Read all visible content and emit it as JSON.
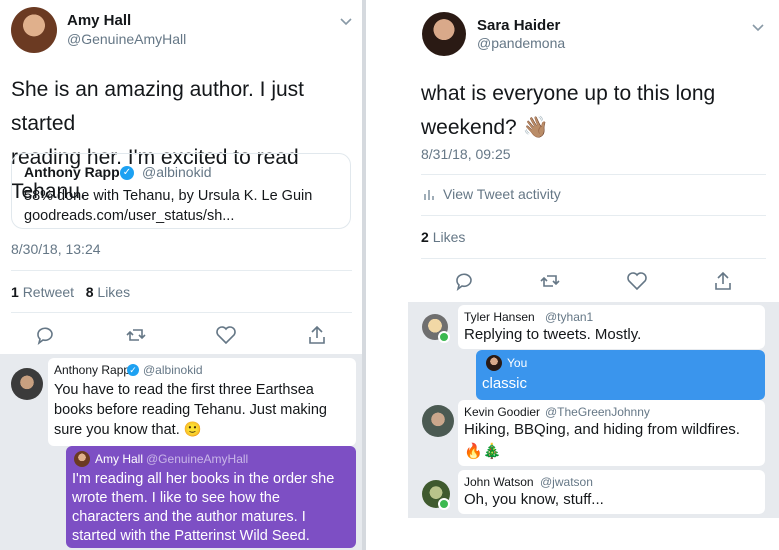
{
  "left_tweet": {
    "author_name": "Amy Hall",
    "author_handle": "@GenuineAmyHall",
    "text_line1": "She is an amazing author. I just started",
    "text_line2": "reading her.  I'm excited to read Tehanu.",
    "quote": {
      "name": "Anthony Rapp",
      "handle": "@albinokid",
      "line1": "58% done with Tehanu, by Ursula K. Le Guin",
      "line2": "goodreads.com/user_status/sh..."
    },
    "timestamp": "8/30/18, 13:24",
    "retweets_count": "1",
    "retweets_label": "Retweet",
    "likes_count": "8",
    "likes_label": "Likes"
  },
  "left_chat": {
    "msg1": {
      "name": "Anthony Rapp",
      "handle": "@albinokid",
      "line1": "You have to read the first three Earthsea",
      "line2": "books before reading Tehanu. Just making",
      "line3": "sure you know that.",
      "emoji": "🙂"
    },
    "msg2": {
      "name": "Amy Hall",
      "handle": "@GenuineAmyHall",
      "line1": "I'm reading all her books in the order she",
      "line2": "wrote them.  I like to see how the",
      "line3": "characters and the author matures.  I",
      "line4": "started with the Patterinst Wild Seed."
    }
  },
  "right_tweet": {
    "author_name": "Sara Haider",
    "author_handle": "@pandemona",
    "text_line1": "what is everyone up to this long",
    "text_line2": "weekend?",
    "emoji": "👋🏽",
    "timestamp": "8/31/18, 09:25",
    "activity_label": "View Tweet activity",
    "likes_count": "2",
    "likes_label": "Likes"
  },
  "right_chat": {
    "msg1": {
      "name": "Tyler Hansen",
      "handle": "@tyhan1",
      "text": "Replying to tweets. Mostly."
    },
    "msg2": {
      "name": "You",
      "text": "classic"
    },
    "msg3": {
      "name": "Kevin Goodier",
      "handle": "@TheGreenJohnny",
      "text": "Hiking, BBQing, and hiding from wildfires.",
      "emoji": "🔥🎄"
    },
    "msg4": {
      "name": "John Watson",
      "handle": "@jwatson",
      "text": "Oh, you know, stuff..."
    }
  },
  "colors": {
    "accent": "#1da1f2",
    "purple_bubble": "#7d4fc4",
    "blue_bubble": "#3a95ed",
    "chat_bg": "#e7eaee",
    "online": "#3cb950"
  },
  "icons": [
    "reply-icon",
    "retweet-icon",
    "like-icon",
    "share-icon",
    "chevron-down-icon",
    "activity-icon",
    "verified-icon"
  ]
}
